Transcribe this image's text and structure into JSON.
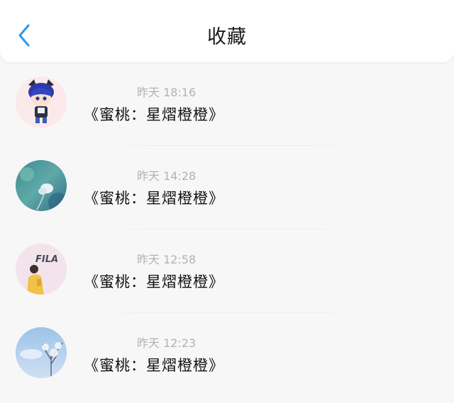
{
  "header": {
    "title": "收藏",
    "back_icon": "chevron-left-icon",
    "accent_color": "#2a9df4"
  },
  "items": [
    {
      "nickname": "",
      "time": "昨天 18:16",
      "content": "《蜜桃：星熠橙橙》",
      "avatar": "cartoon-cat-boy-avatar"
    },
    {
      "nickname": "",
      "time": "昨天 14:28",
      "content": "《蜜桃：星熠橙橙》",
      "avatar": "flower-photo-avatar"
    },
    {
      "nickname": "",
      "time": "昨天 12:58",
      "content": "《蜜桃：星熠橙橙》",
      "avatar": "fila-person-avatar"
    },
    {
      "nickname": "",
      "time": "昨天 12:23",
      "content": "《蜜桃：星熠橙橙》",
      "avatar": "sky-tree-avatar"
    }
  ]
}
